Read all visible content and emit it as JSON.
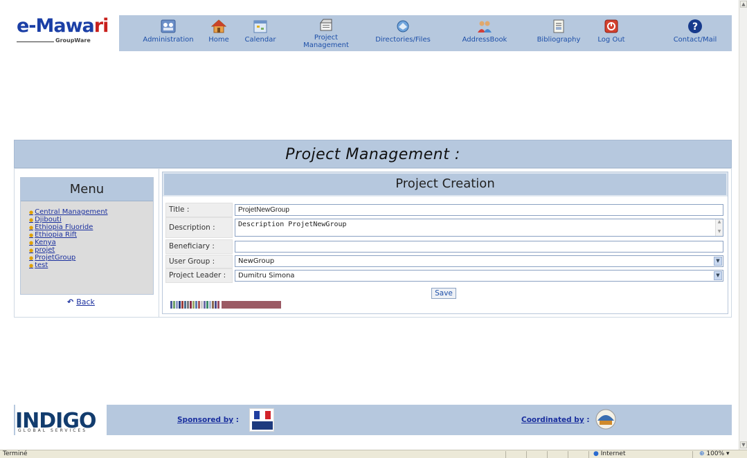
{
  "app": {
    "logo_text_prefix": "e-Mawa",
    "logo_text_suffix": "ri",
    "logo_subtitle": "GroupWare"
  },
  "nav": [
    {
      "label": "Administration",
      "icon": "administration-icon"
    },
    {
      "label": "Home",
      "icon": "home-icon"
    },
    {
      "label": "Calendar",
      "icon": "calendar-icon"
    },
    {
      "label": "Project\nManagement",
      "icon": "project-management-icon"
    },
    {
      "label": "Directories/Files",
      "icon": "directories-icon"
    },
    {
      "label": "AddressBook",
      "icon": "addressbook-icon"
    },
    {
      "label": "Bibliography",
      "icon": "bibliography-icon"
    },
    {
      "label": "Log Out",
      "icon": "logout-icon"
    },
    {
      "label": "Contact/Mail",
      "icon": "contact-mail-icon"
    }
  ],
  "page_title": "Project Management :",
  "menu": {
    "title": "Menu",
    "items": [
      "Central Management",
      "Djibouti",
      "Ethiopia Fluoride",
      "Ethiopia Rift",
      "Kenya",
      "projet",
      "ProjetGroup",
      "test"
    ],
    "back_label": "Back"
  },
  "form": {
    "title": "Project Creation",
    "fields": {
      "title_label": "Title :",
      "title_value": "ProjetNewGroup",
      "description_label": "Description :",
      "description_value": "Description ProjetNewGroup",
      "beneficiary_label": "Beneficiary :",
      "beneficiary_value": "",
      "user_group_label": "User Group :",
      "user_group_value": "NewGroup",
      "project_leader_label": "Project Leader :",
      "project_leader_value": "Dumitru Simona"
    },
    "save_label": "Save",
    "color_swatches": [
      "#4a5a9a",
      "#6fa06a",
      "#8e9bc9",
      "#263d7a",
      "#9c3f3a",
      "#4d6f8e",
      "#7b7b7b",
      "#8b2f4a",
      "#9aa86a",
      "#5e7cb0",
      "#aa5a5a",
      "#c9c9c9",
      "#6a6aa6",
      "#3c8a6a",
      "#a7b5d8",
      "#8a6a50",
      "#4b4b8a",
      "#9a4e62"
    ],
    "long_swatch": "#9b5a64"
  },
  "footer": {
    "indigo_text": "INDIGO",
    "indigo_sub": "GLOBAL SERVICES",
    "sponsored_label": "Sponsored by",
    "sponsored_colon": ":",
    "coordinated_label": "Coordinated by",
    "coordinated_colon": ":"
  },
  "statusbar": {
    "status_text": "Terminé",
    "zone_text": "Internet",
    "zoom_text": "100%"
  },
  "colors": {
    "nav_background": "#b6c8de",
    "link": "#1a2f9e"
  }
}
